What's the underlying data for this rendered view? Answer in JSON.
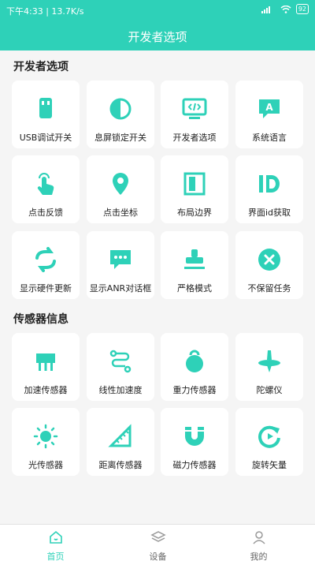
{
  "status_bar": {
    "time_speed": "下午4:33 | 13.7K/s",
    "battery": "92"
  },
  "header": {
    "title": "开发者选项"
  },
  "sections": [
    {
      "title": "开发者选项",
      "items": [
        {
          "label": "USB调试开关",
          "icon": "usb-icon"
        },
        {
          "label": "息屏锁定开关",
          "icon": "half-circle-icon"
        },
        {
          "label": "开发者选项",
          "icon": "monitor-code-icon"
        },
        {
          "label": "系统语言",
          "icon": "language-bubble-icon"
        },
        {
          "label": "点击反馈",
          "icon": "tap-hand-icon"
        },
        {
          "label": "点击坐标",
          "icon": "location-pin-icon"
        },
        {
          "label": "布局边界",
          "icon": "layout-bounds-icon"
        },
        {
          "label": "界面id获取",
          "icon": "id-icon"
        },
        {
          "label": "显示硬件更新",
          "icon": "refresh-arrows-icon"
        },
        {
          "label": "显示ANR对话框",
          "icon": "dialog-dots-icon"
        },
        {
          "label": "严格模式",
          "icon": "stamp-icon"
        },
        {
          "label": "不保留任务",
          "icon": "close-circle-icon"
        }
      ]
    },
    {
      "title": "传感器信息",
      "items": [
        {
          "label": "加速传感器",
          "icon": "chip-icon"
        },
        {
          "label": "线性加速度",
          "icon": "path-icon"
        },
        {
          "label": "重力传感器",
          "icon": "weight-icon"
        },
        {
          "label": "陀螺仪",
          "icon": "gyroscope-icon"
        },
        {
          "label": "光传感器",
          "icon": "sun-icon"
        },
        {
          "label": "距离传感器",
          "icon": "ruler-icon"
        },
        {
          "label": "磁力传感器",
          "icon": "magnet-icon"
        },
        {
          "label": "旋转矢量",
          "icon": "rotate-icon"
        }
      ]
    }
  ],
  "tabbar": {
    "tabs": [
      {
        "label": "首页",
        "icon": "home-icon",
        "active": true
      },
      {
        "label": "设备",
        "icon": "layers-icon",
        "active": false
      },
      {
        "label": "我的",
        "icon": "user-icon",
        "active": false
      }
    ]
  },
  "colors": {
    "accent": "#2ed1b8"
  }
}
